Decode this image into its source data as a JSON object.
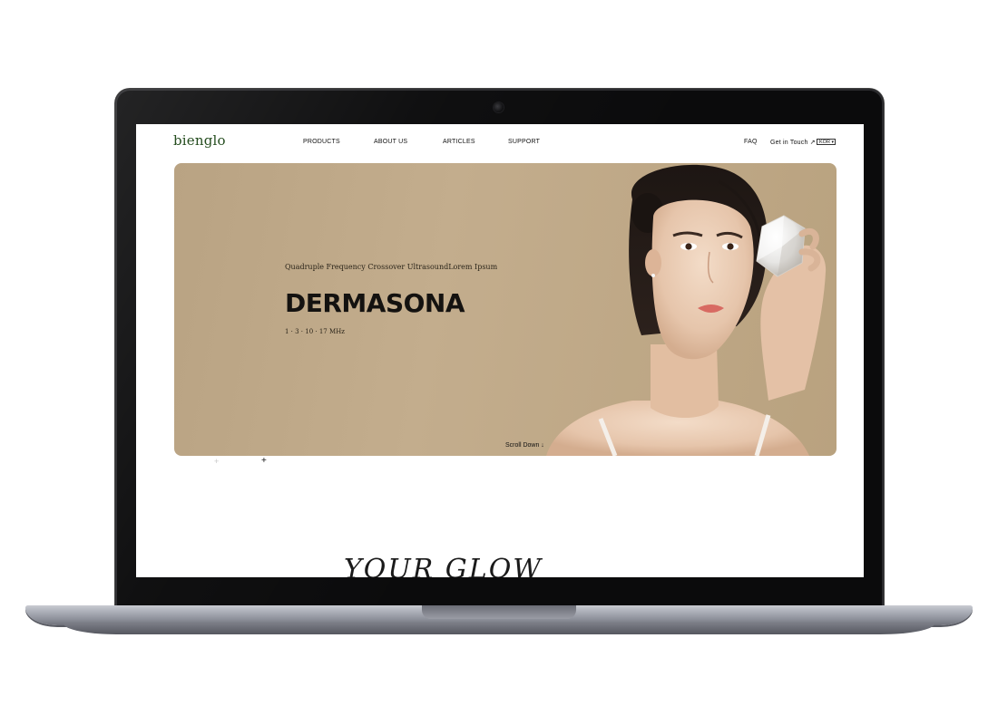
{
  "site": {
    "logo": "bienglo",
    "nav": {
      "products": "PRODUCTS",
      "about": "ABOUT US",
      "articles": "ARTICLES",
      "support": "SUPPORT"
    },
    "utility": {
      "faq": "FAQ",
      "get_in_touch": "Get in Touch ↗",
      "language": "KOR"
    }
  },
  "hero": {
    "subtitle": "Quadruple Frequency Crossover UltrasoundLorem Ipsum",
    "title": "DERMASONA",
    "frequencies": "1 · 3 · 10 · 17 MHz",
    "scroll_label": "Scroll Down ↓",
    "background_color": "#bda786"
  },
  "slider": {
    "marker_inactive": "+",
    "marker_active": "+"
  },
  "section": {
    "heading": "YOUR GLOW"
  },
  "colors": {
    "logo": "#244c1e",
    "laptop_body": "#0b0b0c",
    "laptop_base": "#a9acb5"
  }
}
